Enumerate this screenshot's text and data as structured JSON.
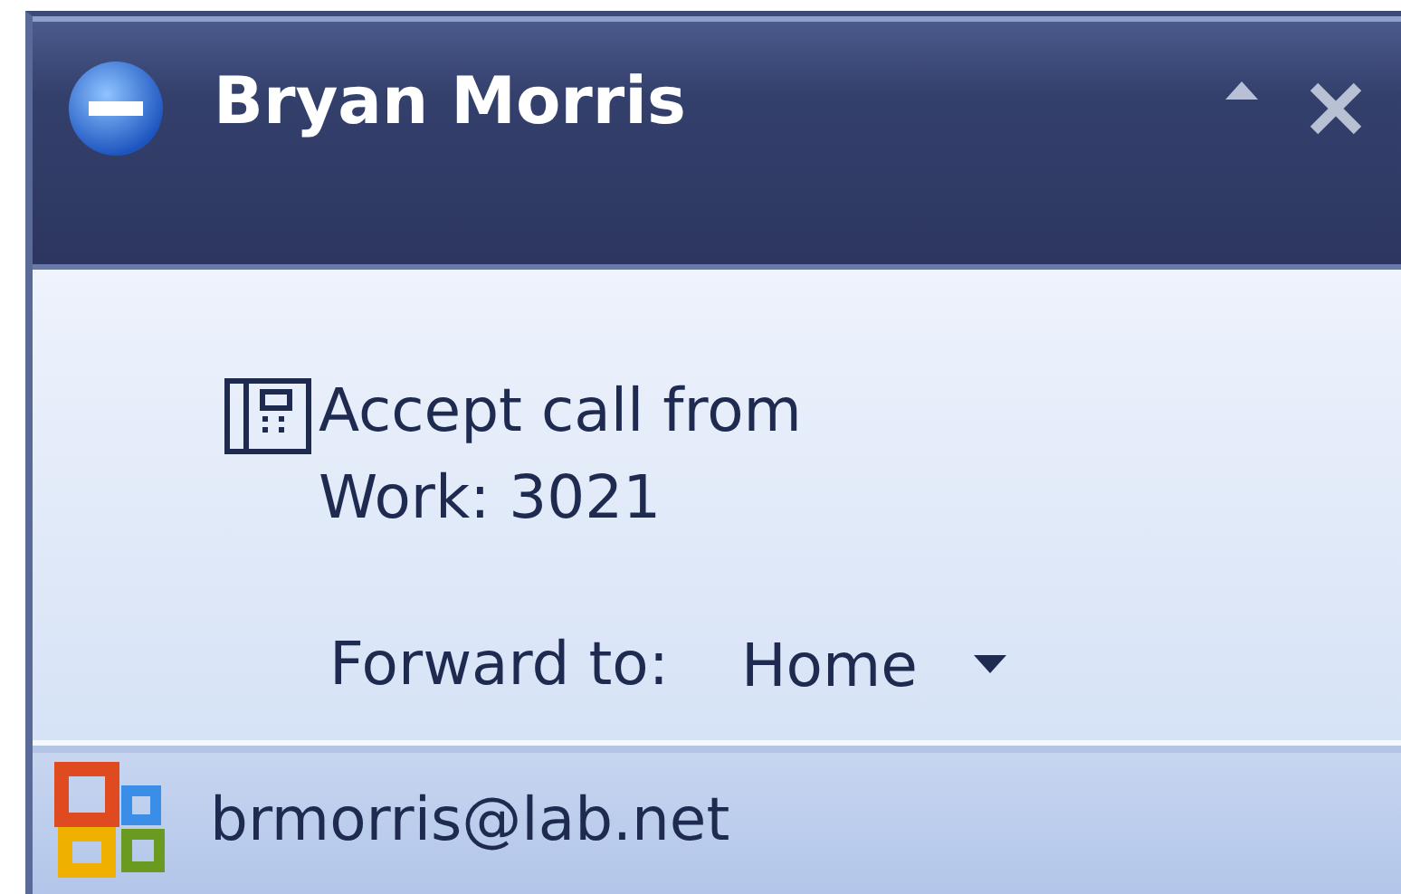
{
  "window": {
    "title": "Bryan Morris"
  },
  "message": {
    "lines": [
      "Accept call from",
      "Work: 3021"
    ]
  },
  "forward": {
    "label": "Forward to:",
    "value": "Home"
  },
  "footer": {
    "account": "brmorris@lab.net"
  }
}
